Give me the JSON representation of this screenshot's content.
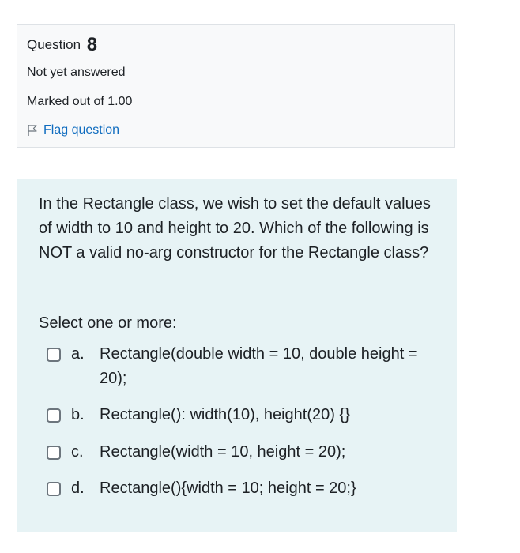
{
  "info": {
    "question_prefix": "Question",
    "question_number": "8",
    "state": "Not yet answered",
    "grade": "Marked out of 1.00",
    "flag_label": "Flag question"
  },
  "question": {
    "text": "In the Rectangle class, we wish to set the default values of width to 10 and height to 20. Which of the following is NOT a valid no-arg constructor for the Rectangle class?",
    "prompt": "Select one or more:",
    "options": [
      {
        "letter": "a.",
        "text": "Rectangle(double width = 10, double height = 20);"
      },
      {
        "letter": "b.",
        "text": "Rectangle(): width(10), height(20) {}"
      },
      {
        "letter": "c.",
        "text": "Rectangle(width = 10, height = 20);"
      },
      {
        "letter": "d.",
        "text": "Rectangle(){width = 10; height = 20;}"
      }
    ]
  },
  "colors": {
    "info_bg": "#f8f9fa",
    "content_bg": "#e7f3f5",
    "link": "#0f6cbf"
  }
}
